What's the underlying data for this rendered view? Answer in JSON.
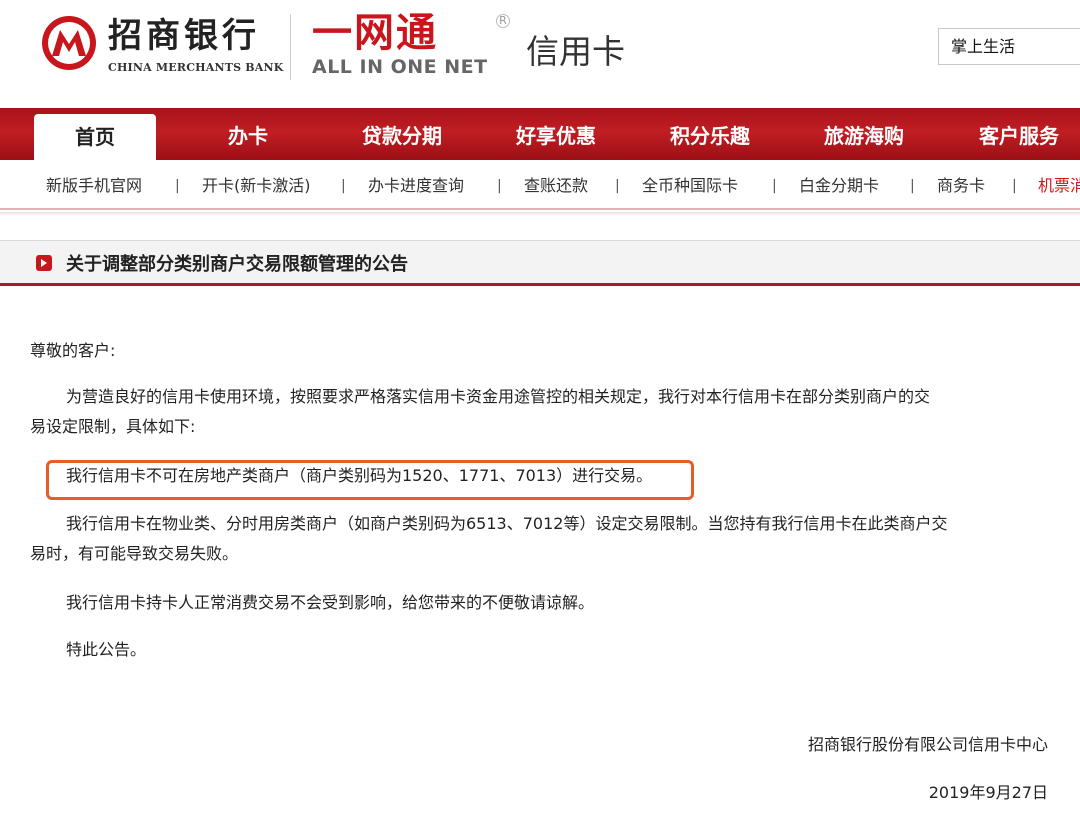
{
  "header": {
    "bank_name_cn": "招商银行",
    "bank_name_en": "CHINA MERCHANTS BANK",
    "brand_cn": "一网通",
    "brand_en": "ALL IN ONE NET",
    "registered_mark": "R",
    "section_title": "信用卡",
    "app_link": "掌上生活",
    "brand_color": "#c8161d"
  },
  "main_nav": [
    {
      "label": "首页",
      "active": true
    },
    {
      "label": "办卡"
    },
    {
      "label": "贷款分期"
    },
    {
      "label": "好享优惠"
    },
    {
      "label": "积分乐趣"
    },
    {
      "label": "旅游海购"
    },
    {
      "label": "客户服务"
    }
  ],
  "sub_nav": {
    "items": [
      "新版手机官网",
      "开卡(新卡激活)",
      "办卡进度查询",
      "查账还款",
      "全币种国际卡",
      "白金分期卡",
      "商务卡",
      "机票消"
    ],
    "separator": "|"
  },
  "article": {
    "title": "关于调整部分类别商户交易限额管理的公告",
    "greeting": "尊敬的客户:",
    "para1_line1": "为营造良好的信用卡使用环境，按照要求严格落实信用卡资金用途管控的相关规定，我行对本行信用卡在部分类别商户的交",
    "para1_line2": "易设定限制，具体如下:",
    "highlight": "我行信用卡不可在房地产类商户（商户类别码为1520、1771、7013）进行交易。",
    "para3_line1": "我行信用卡在物业类、分时用房类商户（如商户类别码为6513、7012等）设定交易限制。当您持有我行信用卡在此类商户交",
    "para3_line2": "易时，有可能导致交易失败。",
    "para4": "我行信用卡持卡人正常消费交易不会受到影响，给您带来的不便敬请谅解。",
    "closing": "特此公告。",
    "signature": "招商银行股份有限公司信用卡中心",
    "date": "2019年9月27日"
  }
}
